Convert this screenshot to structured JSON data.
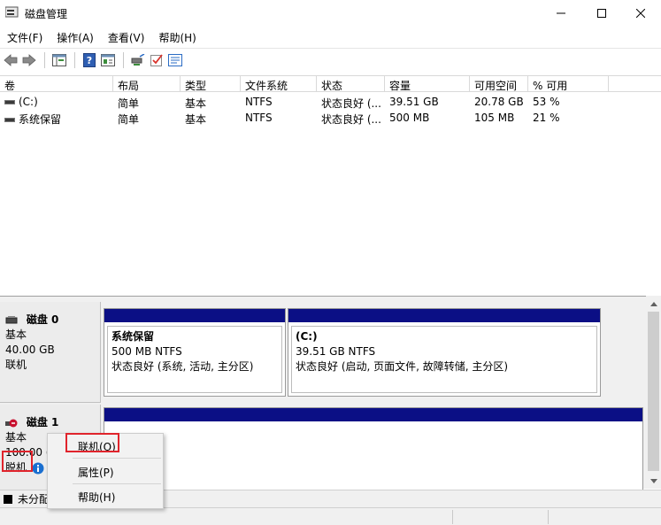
{
  "window": {
    "title": "磁盘管理"
  },
  "menu": [
    "文件(F)",
    "操作(A)",
    "查看(V)",
    "帮助(H)"
  ],
  "toolbar_icons": [
    "back-arrow-icon",
    "forward-arrow-icon",
    "console-tree-icon",
    "help-icon",
    "properties-view-icon",
    "rescan-disks-icon",
    "check-icon",
    "settings-list-icon"
  ],
  "volume_table": {
    "columns": [
      "卷",
      "布局",
      "类型",
      "文件系统",
      "状态",
      "容量",
      "可用空间",
      "% 可用"
    ],
    "rows": [
      {
        "volume": "(C:)",
        "layout": "简单",
        "type": "基本",
        "fs": "NTFS",
        "status": "状态良好 (...",
        "capacity": "39.51 GB",
        "free": "20.78 GB",
        "pct": "53 %"
      },
      {
        "volume": "系统保留",
        "layout": "简单",
        "type": "基本",
        "fs": "NTFS",
        "status": "状态良好 (...",
        "capacity": "500 MB",
        "free": "105 MB",
        "pct": "21 %"
      }
    ]
  },
  "disks": [
    {
      "name": "磁盘 0",
      "type": "基本",
      "size": "40.00 GB",
      "state": "联机",
      "partitions": [
        {
          "name": "系统保留",
          "size": "500 MB NTFS",
          "status": "状态良好 (系统, 活动, 主分区)"
        },
        {
          "name": "(C:)",
          "size": "39.51 GB NTFS",
          "status": "状态良好 (启动, 页面文件, 故障转储, 主分区)"
        }
      ]
    },
    {
      "name": "磁盘 1",
      "type": "基本",
      "size": "100.00 (",
      "state": "脱机"
    }
  ],
  "legend": {
    "unallocated": "未分配"
  },
  "context_menu": {
    "items": [
      "联机(O)",
      "属性(P)",
      "帮助(H)"
    ]
  },
  "colors": {
    "partition_band": "#0b0f85",
    "highlight": "#e0242c",
    "info_icon": "#1a6fd0"
  }
}
